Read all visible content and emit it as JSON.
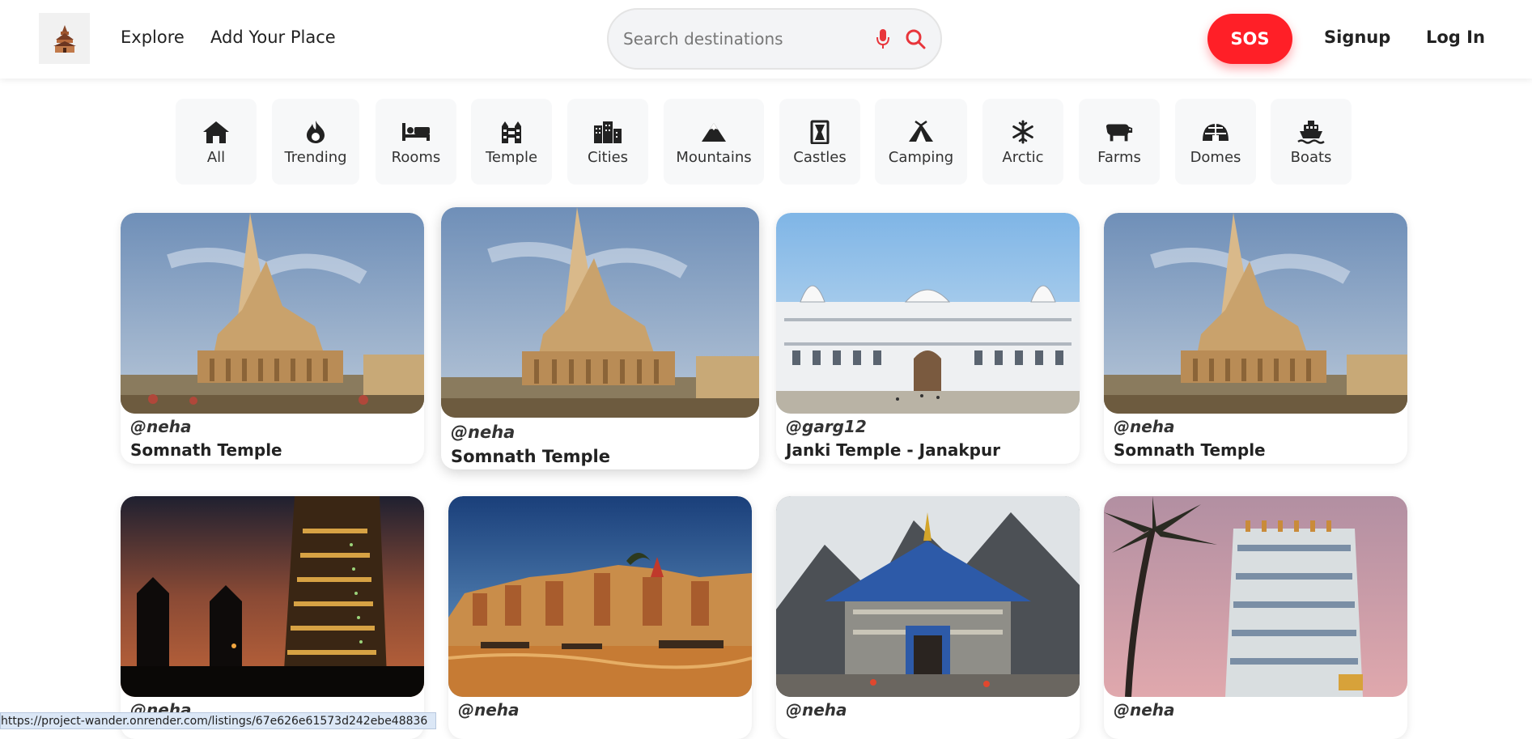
{
  "nav": {
    "explore": "Explore",
    "add_place": "Add Your Place",
    "search_placeholder": "Search destinations",
    "sos": "SOS",
    "signup": "Signup",
    "login": "Log In"
  },
  "categories": [
    {
      "label": "All",
      "icon": "home-icon"
    },
    {
      "label": "Trending",
      "icon": "fire-icon"
    },
    {
      "label": "Rooms",
      "icon": "bed-icon"
    },
    {
      "label": "Temple",
      "icon": "temple-icon"
    },
    {
      "label": "Cities",
      "icon": "city-icon"
    },
    {
      "label": "Mountains",
      "icon": "mountain-icon"
    },
    {
      "label": "Castles",
      "icon": "castle-icon"
    },
    {
      "label": "Camping",
      "icon": "tent-icon"
    },
    {
      "label": "Arctic",
      "icon": "snowflake-icon"
    },
    {
      "label": "Farms",
      "icon": "cow-icon"
    },
    {
      "label": "Domes",
      "icon": "dome-icon"
    },
    {
      "label": "Boats",
      "icon": "ship-icon"
    }
  ],
  "listings": [
    {
      "owner": "@neha",
      "title": "Somnath Temple"
    },
    {
      "owner": "@neha",
      "title": "Somnath Temple"
    },
    {
      "owner": "@garg12",
      "title": "Janki Temple - Janakpur"
    },
    {
      "owner": "@neha",
      "title": "Somnath Temple"
    },
    {
      "owner": "@neha",
      "title": ""
    },
    {
      "owner": "@neha",
      "title": ""
    },
    {
      "owner": "@neha",
      "title": ""
    },
    {
      "owner": "@neha",
      "title": ""
    }
  ],
  "status_url": "https://project-wander.onrender.com/listings/67e626e61573d242ebe48836",
  "colors": {
    "accent": "#ff1f27",
    "chip_bg": "#f7f8f9"
  }
}
